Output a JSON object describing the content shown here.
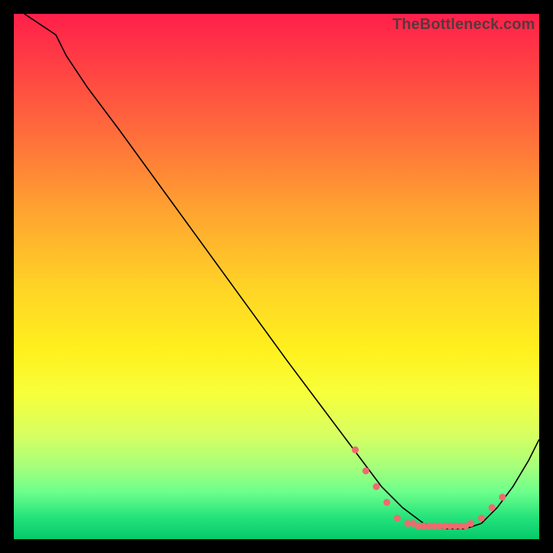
{
  "watermark": "TheBottleneck.com",
  "colors": {
    "curve": "#000000",
    "dot": "#ef6a6e",
    "frame": "#000000"
  },
  "chart_data": {
    "type": "line",
    "title": "",
    "xlabel": "",
    "ylabel": "",
    "xlim": [
      0,
      100
    ],
    "ylim": [
      0,
      100
    ],
    "curve": [
      {
        "x": 2,
        "y": 100
      },
      {
        "x": 8,
        "y": 96
      },
      {
        "x": 10,
        "y": 92
      },
      {
        "x": 14,
        "y": 86
      },
      {
        "x": 20,
        "y": 78
      },
      {
        "x": 28,
        "y": 67
      },
      {
        "x": 36,
        "y": 56
      },
      {
        "x": 44,
        "y": 45
      },
      {
        "x": 52,
        "y": 34
      },
      {
        "x": 58,
        "y": 26
      },
      {
        "x": 64,
        "y": 18
      },
      {
        "x": 70,
        "y": 10
      },
      {
        "x": 74,
        "y": 6
      },
      {
        "x": 78,
        "y": 3
      },
      {
        "x": 82,
        "y": 2
      },
      {
        "x": 86,
        "y": 2
      },
      {
        "x": 89,
        "y": 3
      },
      {
        "x": 92,
        "y": 6
      },
      {
        "x": 95,
        "y": 10
      },
      {
        "x": 98,
        "y": 15
      },
      {
        "x": 100,
        "y": 19
      }
    ],
    "dots": [
      {
        "x": 65,
        "y": 17
      },
      {
        "x": 67,
        "y": 13
      },
      {
        "x": 69,
        "y": 10
      },
      {
        "x": 71,
        "y": 7
      },
      {
        "x": 73,
        "y": 4
      },
      {
        "x": 75,
        "y": 3
      },
      {
        "x": 76,
        "y": 3
      },
      {
        "x": 77,
        "y": 2.5
      },
      {
        "x": 78,
        "y": 2.5
      },
      {
        "x": 79,
        "y": 2.5
      },
      {
        "x": 80,
        "y": 2.5
      },
      {
        "x": 81,
        "y": 2.5
      },
      {
        "x": 82,
        "y": 2.5
      },
      {
        "x": 83,
        "y": 2.5
      },
      {
        "x": 84,
        "y": 2.5
      },
      {
        "x": 85,
        "y": 2.5
      },
      {
        "x": 86,
        "y": 2.5
      },
      {
        "x": 87,
        "y": 3
      },
      {
        "x": 89,
        "y": 4
      },
      {
        "x": 91,
        "y": 6
      },
      {
        "x": 93,
        "y": 8
      }
    ]
  }
}
